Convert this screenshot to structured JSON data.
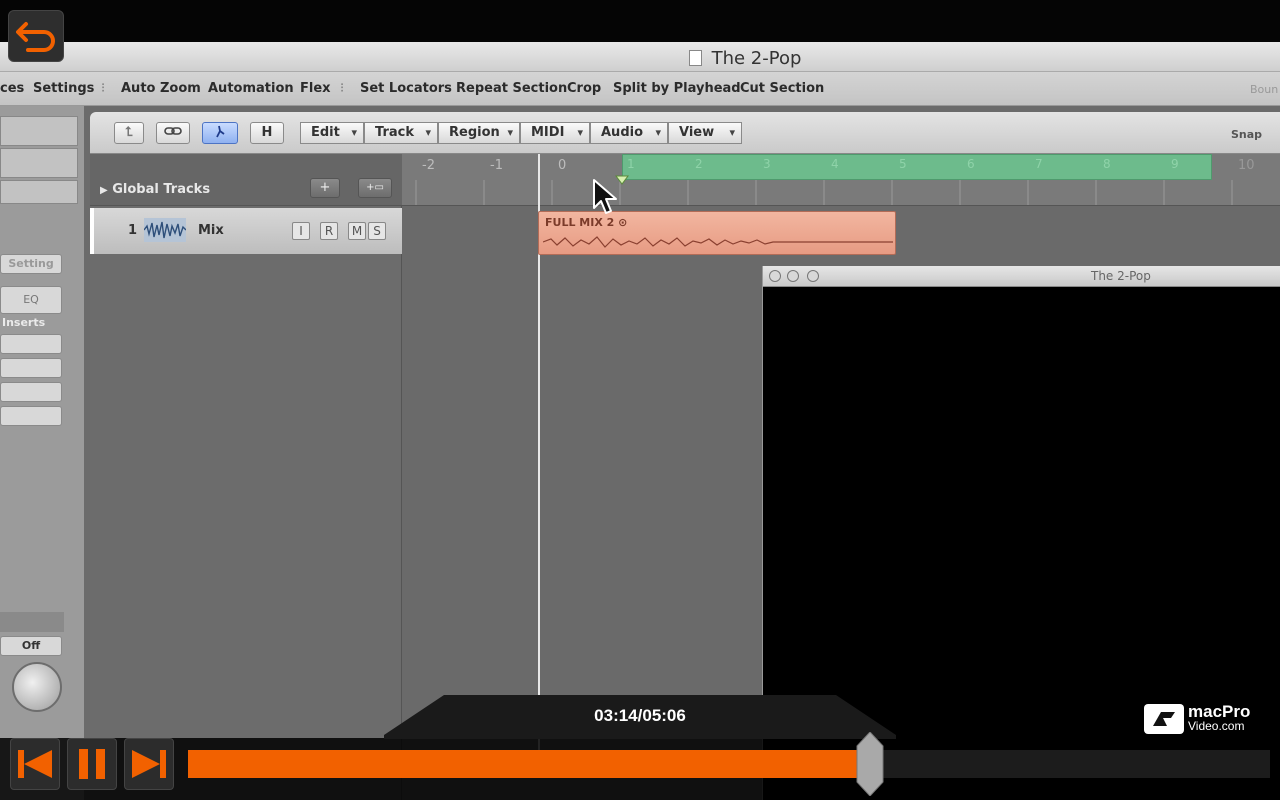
{
  "window": {
    "title": "The 2-Pop"
  },
  "toolbar": {
    "items": [
      "ces",
      "Settings",
      "Auto Zoom",
      "Automation",
      "Flex",
      "Set Locators",
      "Repeat Section",
      "Crop",
      "Split by Playhead",
      "Cut Section"
    ],
    "faded_right": "Boun"
  },
  "inspector": {
    "setting_label": "Setting",
    "eq_label": "EQ",
    "inserts_label": "Inserts",
    "off_label": "Off"
  },
  "local_bar": {
    "h_button": "H",
    "menus": [
      "Edit",
      "Track",
      "Region",
      "MIDI",
      "Audio",
      "View"
    ],
    "snap_label": "Snap"
  },
  "tracks": {
    "global_tracks_label": "Global Tracks",
    "add_button": "+",
    "folder_button": "+▭",
    "row": {
      "number": "1",
      "name": "Mix",
      "buttons": [
        "I",
        "R",
        "M",
        "S"
      ]
    }
  },
  "ruler": {
    "labels": [
      "-2",
      "-1",
      "0"
    ],
    "cycle_labels": [
      "1",
      "2",
      "3",
      "4",
      "5",
      "6",
      "7",
      "8",
      "9"
    ],
    "far_label": "10"
  },
  "region": {
    "name": "FULL MIX 2 ⊙"
  },
  "movie_window": {
    "title": "The 2-Pop"
  },
  "player": {
    "time": "03:14/05:06",
    "progress": 0.63,
    "accent": "#f26100"
  },
  "brand": {
    "line1": "macPro",
    "line2": "Video.com"
  }
}
